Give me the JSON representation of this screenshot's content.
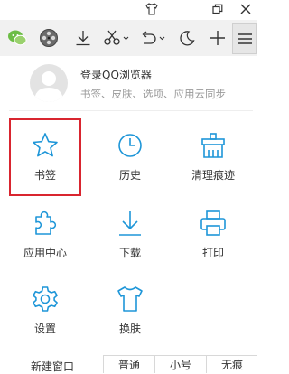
{
  "titlebar": {
    "icons": [
      "tshirt-icon",
      "restore-window-icon",
      "close-icon"
    ]
  },
  "toolbar": {
    "icons": [
      "wechat-icon",
      "film-icon",
      "download-icon",
      "scissors-icon",
      "undo-icon",
      "moon-icon",
      "plus-icon",
      "menu-icon"
    ]
  },
  "account": {
    "login_label": "登录QQ浏览器",
    "subtitle": "书签、皮肤、选项、应用云同步"
  },
  "grid": [
    {
      "label": "书签",
      "icon": "star-icon"
    },
    {
      "label": "历史",
      "icon": "clock-icon"
    },
    {
      "label": "清理痕迹",
      "icon": "cleanup-icon"
    },
    {
      "label": "应用中心",
      "icon": "puzzle-icon"
    },
    {
      "label": "下载",
      "icon": "download-icon"
    },
    {
      "label": "打印",
      "icon": "printer-icon"
    },
    {
      "label": "设置",
      "icon": "gear-icon"
    },
    {
      "label": "换肤",
      "icon": "tshirt-icon"
    }
  ],
  "bottom": {
    "new_window_label": "新建窗口",
    "modes": [
      "普通",
      "小号",
      "无痕"
    ]
  },
  "colors": {
    "accent": "#1e96d8",
    "selection": "#d9252f"
  }
}
